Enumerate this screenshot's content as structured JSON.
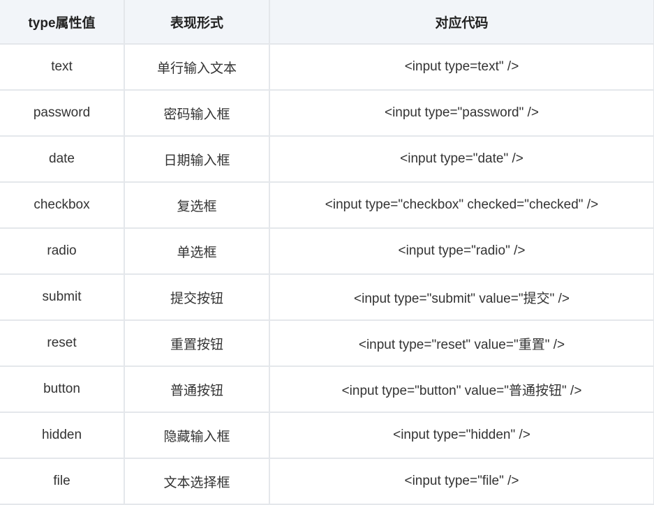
{
  "headers": [
    "type属性值",
    "表现形式",
    "对应代码"
  ],
  "rows": [
    {
      "type": "text",
      "form": "单行输入文本",
      "code": "<input type=text\" />"
    },
    {
      "type": "password",
      "form": "密码输入框",
      "code": "<input type=\"password\"  />"
    },
    {
      "type": "date",
      "form": "日期输入框",
      "code": "<input type=\"date\" />"
    },
    {
      "type": "checkbox",
      "form": "复选框",
      "code": "<input type=\"checkbox\" checked=\"checked\"  />"
    },
    {
      "type": "radio",
      "form": "单选框",
      "code": "<input type=\"radio\"  />"
    },
    {
      "type": "submit",
      "form": "提交按钮",
      "code": "<input type=\"submit\" value=\"提交\" />"
    },
    {
      "type": "reset",
      "form": "重置按钮",
      "code": "<input type=\"reset\" value=\"重置\"  />"
    },
    {
      "type": "button",
      "form": "普通按钮",
      "code": "<input type=\"button\" value=\"普通按钮\"  />"
    },
    {
      "type": "hidden",
      "form": "隐藏输入框",
      "code": "<input type=\"hidden\"  />"
    },
    {
      "type": "file",
      "form": "文本选择框",
      "code": "<input type=\"file\"  />"
    }
  ]
}
